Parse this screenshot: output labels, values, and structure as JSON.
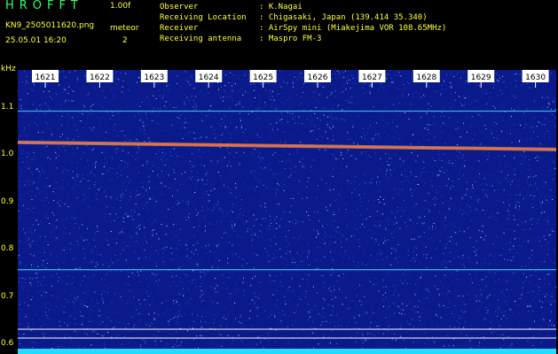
{
  "app": {
    "title": "HROFFT",
    "version": "1.00f",
    "filename": "KN9_2505011620.png",
    "datetime": "25.05.01 16:20",
    "meteor_label": "meteor",
    "meteor_count": "2"
  },
  "meta": [
    {
      "key": "Observer",
      "value": ": K.Nagai"
    },
    {
      "key": "Receiving Location",
      "value": ": Chigasaki, Japan (139.414 35.340)"
    },
    {
      "key": "Receiver",
      "value": ": AirSpy mini (Miakejima VOR 108.65MHz)"
    },
    {
      "key": "Receiving antenna",
      "value": ": Maspro FM-3"
    }
  ],
  "y_axis": {
    "unit": "kHz",
    "ticks": [
      "1.1",
      "1.0",
      "0.9",
      "0.8",
      "0.7",
      "0.6"
    ]
  },
  "x_axis": {
    "ticks": [
      "1621",
      "1622",
      "1623",
      "1624",
      "1625",
      "1626",
      "1627",
      "1628",
      "1629",
      "1630"
    ]
  },
  "colors": {
    "background": "#0a1a8a",
    "text": "#ffff33",
    "title": "#33ff66",
    "tick_label_bg": "#ffffff",
    "signal": "#ff6644",
    "reference_line": "#33ddff"
  },
  "chart_data": {
    "type": "heatmap",
    "title": "",
    "xlabel": "",
    "ylabel": "kHz",
    "x_ticks": [
      "1621",
      "1622",
      "1623",
      "1624",
      "1625",
      "1626",
      "1627",
      "1628",
      "1629",
      "1630"
    ],
    "y_ticks": [
      1.1,
      1.0,
      0.9,
      0.8,
      0.7,
      0.6
    ],
    "ylim": [
      0.58,
      1.18
    ],
    "features": [
      {
        "kind": "carrier",
        "y_start": 1.027,
        "y_end": 1.012
      },
      {
        "kind": "reference-line",
        "y": 1.093
      },
      {
        "kind": "reference-line",
        "y": 0.758
      }
    ]
  }
}
